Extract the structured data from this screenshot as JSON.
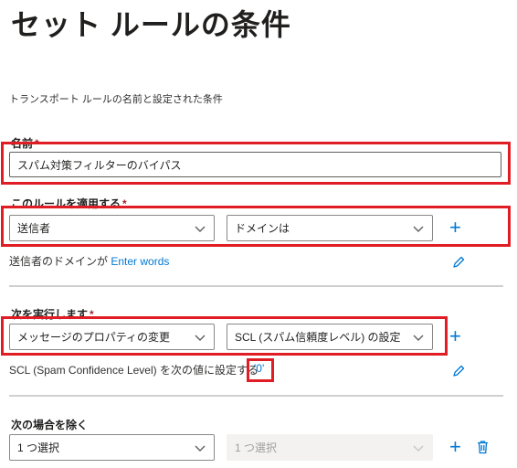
{
  "page": {
    "title": "セット ルールの条件",
    "subtitle": "トランスポート ルールの名前と設定された条件"
  },
  "name_field": {
    "label": "名前",
    "required_mark": "*",
    "value": "スパム対策フィルターのバイパス"
  },
  "apply_rule": {
    "label": "このルールを適用する",
    "required_mark": "*",
    "dropdown1": "送信者",
    "dropdown2": "ドメインは",
    "description_prefix": "送信者のドメインが",
    "description_link": "Enter words"
  },
  "do_following": {
    "label": "次を実行します",
    "required_mark": "*",
    "dropdown1": "メッセージのプロパティの変更",
    "dropdown2": "SCL (スパム信頼度レベル) の設定",
    "description_prefix": "SCL (Spam Confidence Level) を次の値に設定する",
    "description_link": "'0'"
  },
  "except_if": {
    "label": "次の場合を除く",
    "dropdown1": "1 つ選択",
    "dropdown2": "1 つ選択"
  },
  "icons": [
    "chevron-down-icon",
    "plus-icon",
    "pencil-icon",
    "trash-icon"
  ],
  "colors": {
    "accent": "#0078d4",
    "highlight_box": "#e01c24",
    "required": "#a4262c"
  }
}
